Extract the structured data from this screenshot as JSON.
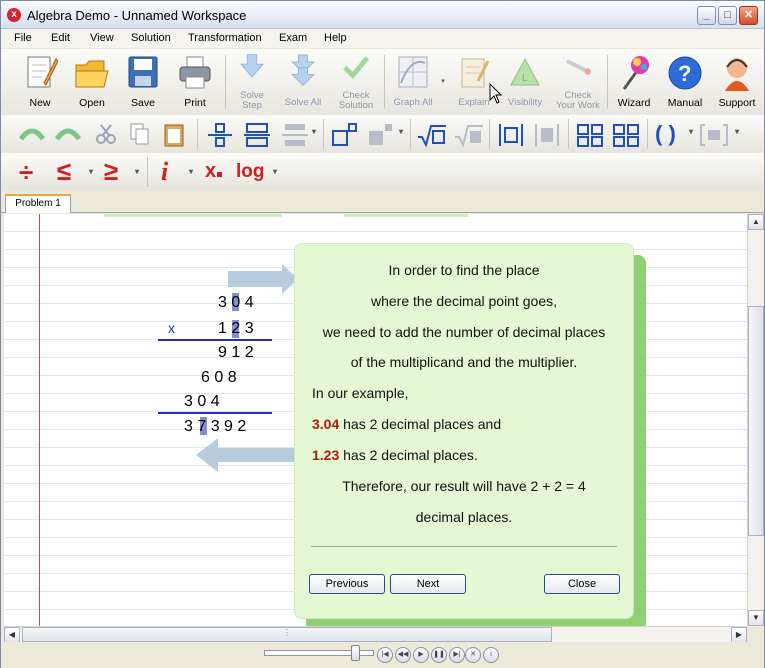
{
  "window": {
    "title": "Algebra Demo - Unnamed Workspace",
    "min": "_",
    "max": "□",
    "close": "✕"
  },
  "menu": [
    "File",
    "Edit",
    "View",
    "Solution",
    "Transformation",
    "Exam",
    "Help"
  ],
  "toolbar": {
    "new": "New",
    "open": "Open",
    "save": "Save",
    "print": "Print",
    "solve_step_1": "Solve",
    "solve_step_2": "Step",
    "solve_all": "Solve All",
    "check_solution_1": "Check",
    "check_solution_2": "Solution",
    "graph_all": "Graph All",
    "explain": "Explain",
    "visibility": "Visibility",
    "check_work_1": "Check",
    "check_work_2": "Your Work",
    "wizard": "Wizard",
    "manual": "Manual",
    "support": "Support"
  },
  "math_toolbar": {
    "divide": "÷",
    "leq": "≤",
    "geq": "≥",
    "imag": "i",
    "sub": "x",
    "log": "log",
    "paren": "( )"
  },
  "tabs": [
    "Problem 1"
  ],
  "calc": {
    "mult1": "3 0 4",
    "times": "x",
    "mult2": "1 2 3",
    "row1": "9 1 2",
    "row2": "6 0 8",
    "row3": "3 0 4",
    "result": "3 7 3 9 2"
  },
  "popup": {
    "line1": "In order to find the place",
    "line2": "where the decimal point goes,",
    "line3": "we need to add the number of decimal places",
    "line4": "of the multiplicand and the multiplier.",
    "line5": "In our example,",
    "num1": "3.04",
    "line6_rest": " has 2 decimal places and",
    "num2": "1.23",
    "line7_rest": " has 2 decimal places.",
    "line8": "Therefore, our result will have 2 + 2 = 4",
    "line9": "decimal places.",
    "previous": "Previous",
    "next": "Next",
    "close": "Close"
  },
  "colors": {
    "accent_red": "#b01818",
    "popup_bg": "#e4f8d4",
    "rule_blue": "#2030b0"
  }
}
